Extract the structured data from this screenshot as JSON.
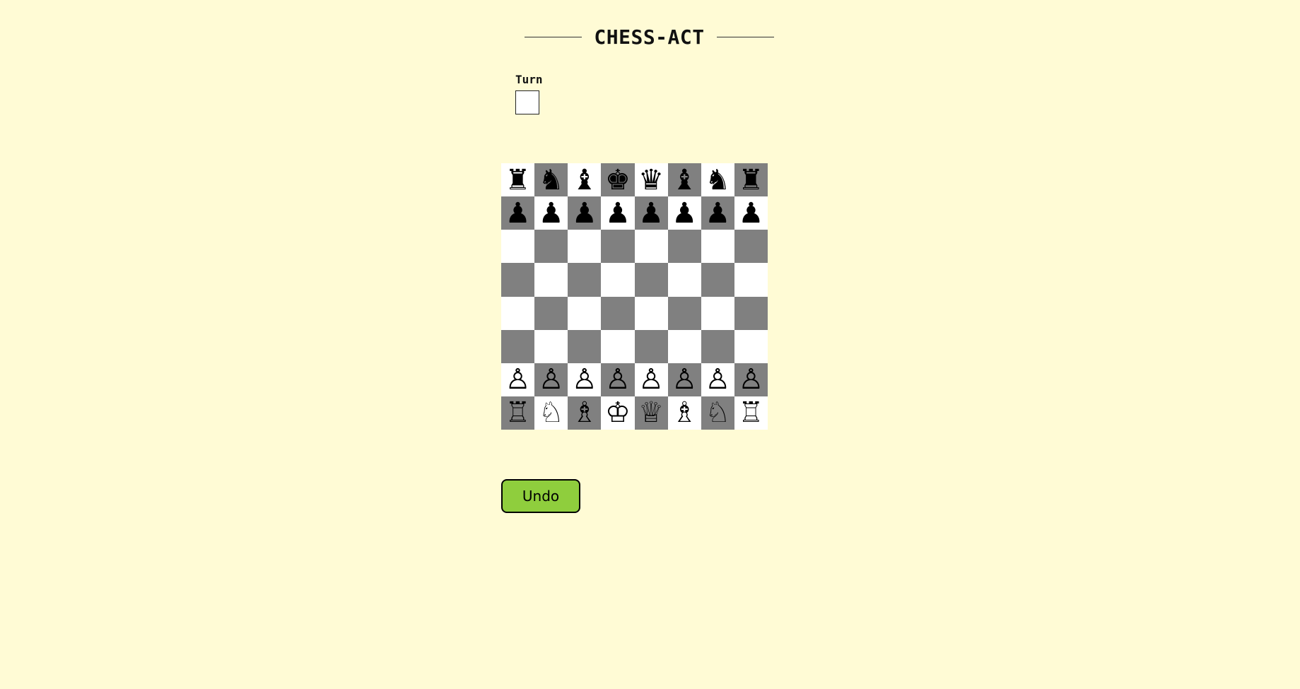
{
  "header": {
    "title": "CHESS-ACT"
  },
  "turn": {
    "label": "Turn",
    "current_color": "white",
    "indicator_color": "#ffffff"
  },
  "board": {
    "light_color": "#ffffff",
    "dark_color": "#808080",
    "first_square": "light",
    "pieces": [
      [
        "♜",
        "♞",
        "♝",
        "♚",
        "♛",
        "♝",
        "♞",
        "♜"
      ],
      [
        "♟",
        "♟",
        "♟",
        "♟",
        "♟",
        "♟",
        "♟",
        "♟"
      ],
      [
        "",
        "",
        "",
        "",
        "",
        "",
        "",
        ""
      ],
      [
        "",
        "",
        "",
        "",
        "",
        "",
        "",
        ""
      ],
      [
        "",
        "",
        "",
        "",
        "",
        "",
        "",
        ""
      ],
      [
        "",
        "",
        "",
        "",
        "",
        "",
        "",
        ""
      ],
      [
        "♙",
        "♙",
        "♙",
        "♙",
        "♙",
        "♙",
        "♙",
        "♙"
      ],
      [
        "♖",
        "♘",
        "♗",
        "♔",
        "♕",
        "♗",
        "♘",
        "♖"
      ]
    ]
  },
  "controls": {
    "undo_label": "Undo",
    "undo_color": "#8fce3d"
  },
  "page": {
    "background": "#fffbd5"
  }
}
